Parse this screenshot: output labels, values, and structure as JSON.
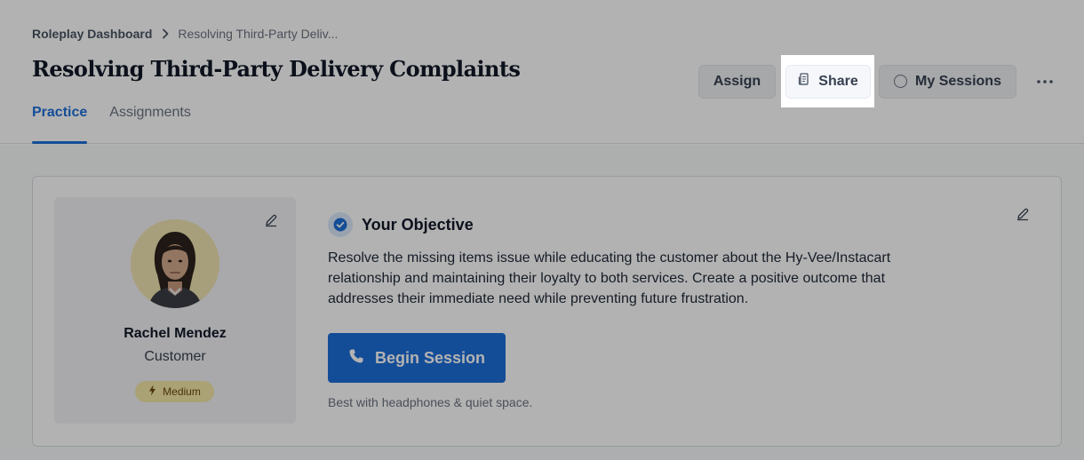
{
  "breadcrumb": {
    "root": "Roleplay Dashboard",
    "current": "Resolving Third-Party Deliv..."
  },
  "page": {
    "title": "Resolving Third-Party Delivery Complaints"
  },
  "tabs": [
    {
      "label": "Practice",
      "active": true
    },
    {
      "label": "Assignments",
      "active": false
    }
  ],
  "actions": {
    "assign_label": "Assign",
    "share_label": "Share",
    "sessions_label": "My Sessions",
    "more_icon": "more-horizontal-icon"
  },
  "persona": {
    "name": "Rachel Mendez",
    "role": "Customer",
    "difficulty": "Medium"
  },
  "objective": {
    "title": "Your Objective",
    "text": "Resolve the missing items issue while educating the customer about the Hy-Vee/Instacart relationship and maintaining their loyalty to both services. Create a positive outcome that addresses their immediate need while preventing future frustration."
  },
  "session": {
    "begin_label": "Begin Session",
    "hint": "Best with headphones & quiet space."
  },
  "colors": {
    "accent": "#1d6fd8",
    "badge_bg": "#f4e7a8",
    "overlay": "rgba(0,0,0,0.30)"
  }
}
